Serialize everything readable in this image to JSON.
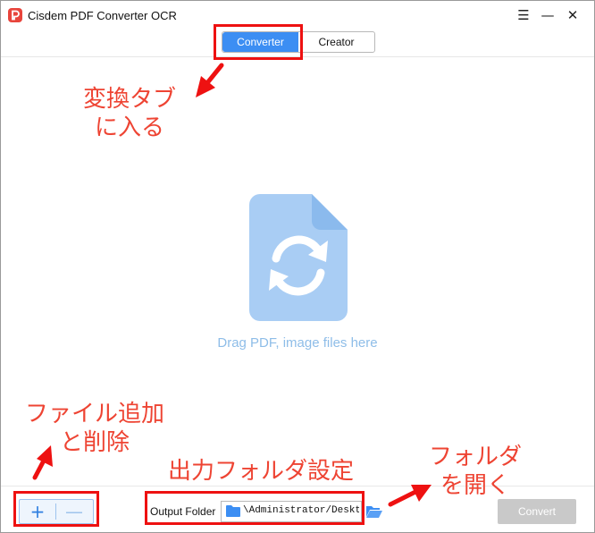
{
  "app": {
    "title": "Cisdem PDF Converter OCR"
  },
  "window_controls": {
    "menu": "☰",
    "minimize": "—",
    "close": "✕"
  },
  "tabs": [
    {
      "label": "Converter",
      "active": true
    },
    {
      "label": "Creator",
      "active": false
    }
  ],
  "drop_zone": {
    "hint": "Drag PDF, image files here",
    "icon": "file-convert-icon"
  },
  "bottom_bar": {
    "add_label": "+",
    "remove_label": "—",
    "output_folder_label": "Output Folder",
    "output_path": "\\Administrator/Desktop",
    "convert_label": "Convert"
  },
  "annotations": {
    "tab_note": [
      "変換タブ",
      "に入る"
    ],
    "add_remove_note": [
      "ファイル追加",
      "と削除"
    ],
    "output_note": [
      "出力フォルダ設定"
    ],
    "open_folder_note": [
      "フォルダ",
      "を開く"
    ]
  },
  "colors": {
    "accent": "#3c8ef3",
    "file_icon": "#a9cdf4",
    "annotation": "#ee4433",
    "highlight_box": "#ee1111",
    "convert_disabled": "#c9c9c9"
  }
}
